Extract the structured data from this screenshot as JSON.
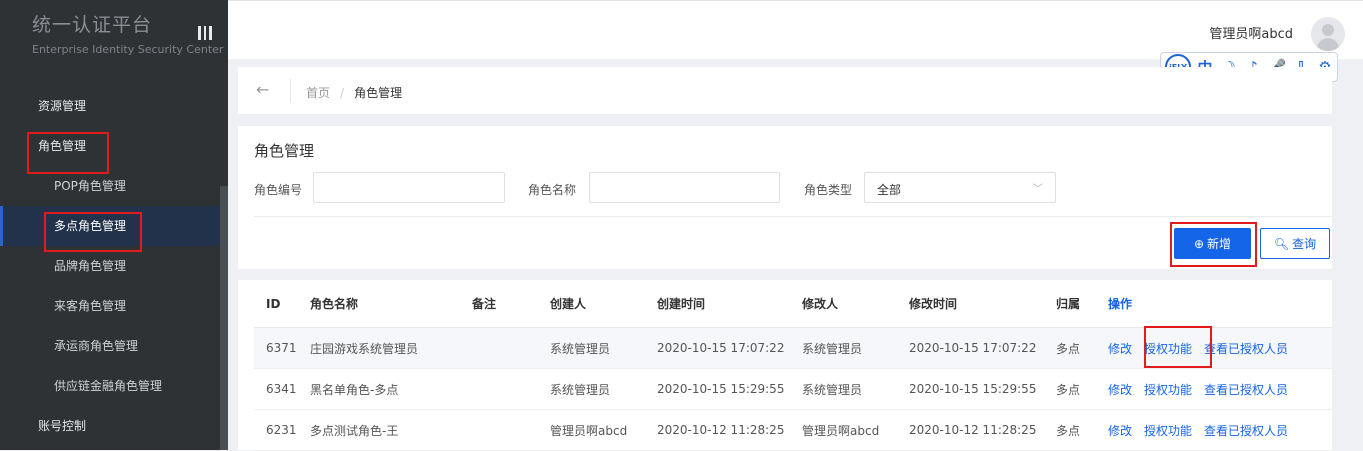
{
  "sidebar": {
    "title": "统一认证平台",
    "subtitle": "Enterprise Identity Security Center",
    "items": [
      {
        "label": "资源管理"
      },
      {
        "label": "角色管理"
      },
      {
        "label": "POP角色管理"
      },
      {
        "label": "多点角色管理"
      },
      {
        "label": "品牌角色管理"
      },
      {
        "label": "来客角色管理"
      },
      {
        "label": "承运商角色管理"
      },
      {
        "label": "供应链金融角色管理"
      },
      {
        "label": "账号控制"
      }
    ]
  },
  "header": {
    "user_name": "管理员啊abcd",
    "toolbar": {
      "logo": "iFLY",
      "icons": [
        "中",
        "☽",
        "♪",
        "🎤",
        "⇩",
        "⚙"
      ]
    }
  },
  "breadcrumb": {
    "home": "首页",
    "separator": "/",
    "current": "角色管理"
  },
  "filter": {
    "title": "角色管理",
    "id_label": "角色编号",
    "id_value": "",
    "name_label": "角色名称",
    "name_value": "",
    "type_label": "角色类型",
    "type_value": "全部",
    "add_label": "新增",
    "query_label": "查询"
  },
  "table": {
    "columns": [
      "ID",
      "角色名称",
      "备注",
      "创建人",
      "创建时间",
      "修改人",
      "修改时间",
      "归属",
      "操作"
    ],
    "rows": [
      {
        "id": "6371",
        "name": "庄园游戏系统管理员",
        "note": "",
        "creator": "系统管理员",
        "created": "2020-10-15 17:07:22",
        "modifier": "系统管理员",
        "modified": "2020-10-15 17:07:22",
        "owner": "多点"
      },
      {
        "id": "6341",
        "name": "黑名单角色-多点",
        "note": "",
        "creator": "系统管理员",
        "created": "2020-10-15 15:29:55",
        "modifier": "系统管理员",
        "modified": "2020-10-15 15:29:55",
        "owner": "多点"
      },
      {
        "id": "6231",
        "name": "多点测试角色-王",
        "note": "",
        "creator": "管理员啊abcd",
        "created": "2020-10-12 11:28:25",
        "modifier": "管理员啊abcd",
        "modified": "2020-10-12 11:28:25",
        "owner": "多点"
      }
    ],
    "actions": {
      "edit": "修改",
      "grant": "授权功能",
      "view": "查看已授权人员"
    }
  },
  "colors": {
    "accent": "#1565e8",
    "sidebar_bg": "#2f3235",
    "highlight": "#e21c1c"
  }
}
